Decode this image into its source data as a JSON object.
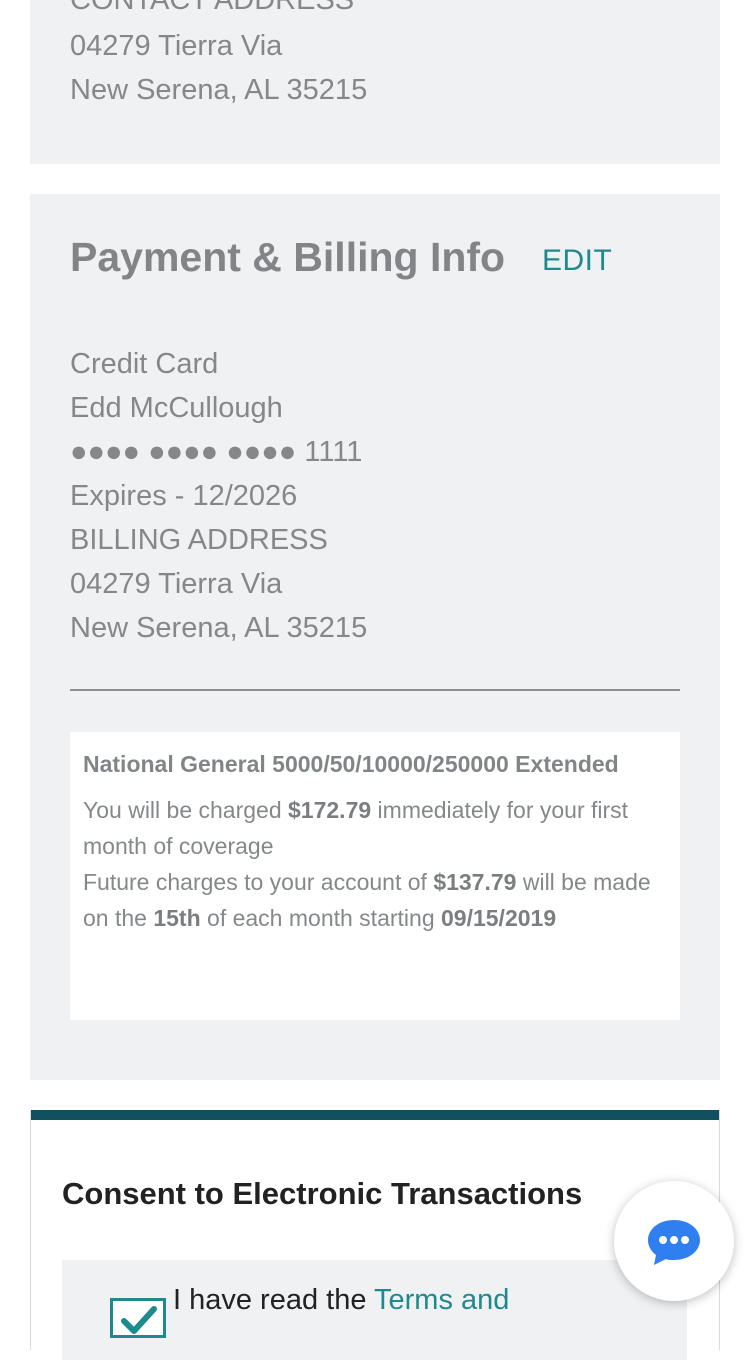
{
  "contact": {
    "heading": "CONTACT ADDRESS",
    "street": "04279 Tierra Via",
    "city_line": "New Serena, AL 35215"
  },
  "payment": {
    "title": "Payment & Billing Info",
    "edit_label": "EDIT",
    "method": "Credit Card",
    "cardholder": "Edd McCullough",
    "card_number": "●●●● ●●●● ●●●● 1111",
    "expires": "Expires - 12/2026",
    "billing_heading": "BILLING ADDRESS",
    "billing_street": "04279 Tierra Via",
    "billing_city_line": "New Serena, AL 35215"
  },
  "summary": {
    "plan_name": "National General 5000/50/10000/250000 Extended",
    "charge_prefix": "You will be charged ",
    "charge_amount": "$172.79",
    "charge_suffix": " immediately for your first month of coverage",
    "future_prefix": "Future charges to your account of ",
    "future_amount": "$137.79",
    "future_middle": " will be made on the ",
    "future_day": "15th",
    "future_suffix": " of each month starting ",
    "start_date": "09/15/2019"
  },
  "consent": {
    "title": "Consent to Electronic Transactions",
    "checkbox_checked": true,
    "terms_prefix": "I have read the ",
    "terms_link": "Terms and"
  },
  "chat": {
    "icon": "chat-bubble-icon"
  },
  "colors": {
    "accent": "#1f8a8e",
    "consent_bar": "#10505f",
    "card_bg": "#f0f1f3"
  }
}
